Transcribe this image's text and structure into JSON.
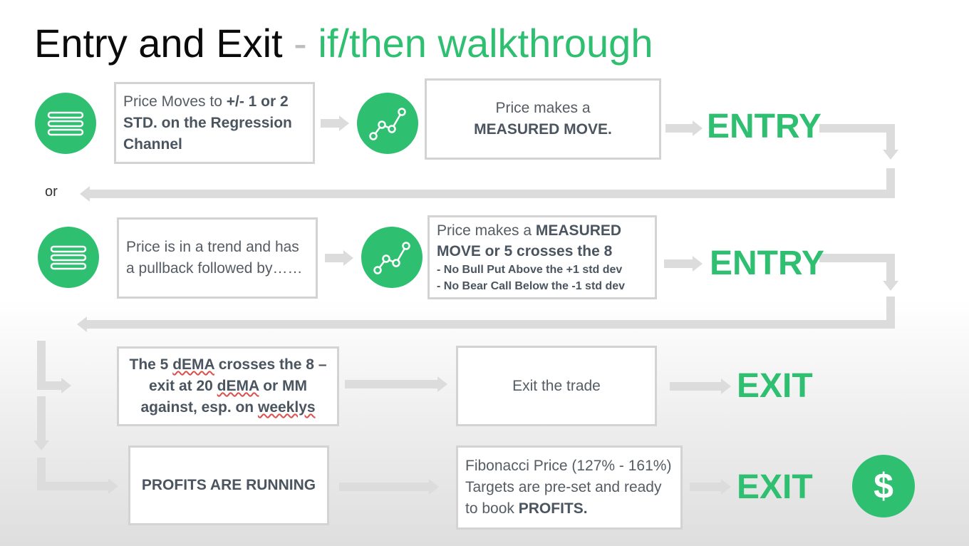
{
  "title": {
    "main": "Entry and Exit",
    "sep": "-",
    "sub": "if/then walkthrough"
  },
  "colors": {
    "accent": "#2fbf71",
    "box_border": "#d3d3d3",
    "arrow": "#dcdcdc",
    "text": "#555c63"
  },
  "icons": {
    "list": "list-icon",
    "chart": "line-chart-icon",
    "dollar": "dollar-icon"
  },
  "row1": {
    "box1": {
      "pre": "Price Moves to ",
      "bold": "+/- 1 or 2 STD. on the Regression Channel"
    },
    "box2": {
      "line1": "Price makes a",
      "line2": "MEASURED MOVE."
    },
    "result": "ENTRY"
  },
  "or_label": "or",
  "row2": {
    "box1": "Price is in a trend and has a pullback followed by……",
    "box2": {
      "pre": "Price makes a ",
      "bold": "MEASURED MOVE or 5 crosses the 8",
      "note1": "- No Bull Put Above the +1 std dev",
      "note2": "- No Bear Call Below the -1 std dev"
    },
    "result": "ENTRY"
  },
  "row3": {
    "box1": {
      "p1": "The 5 ",
      "u1": "dEMA",
      "p2": " crosses the 8 – exit at 20 ",
      "u2": "dEMA",
      "p3": " or MM against, esp. on ",
      "u3": "weeklys"
    },
    "box2": "Exit the trade",
    "result": "EXIT"
  },
  "row4": {
    "box1": "PROFITS ARE RUNNING",
    "box2": {
      "pre": "Fibonacci Price (127% - 161%) Targets are pre-set and ready to book ",
      "bold": "PROFITS."
    },
    "result": "EXIT"
  }
}
